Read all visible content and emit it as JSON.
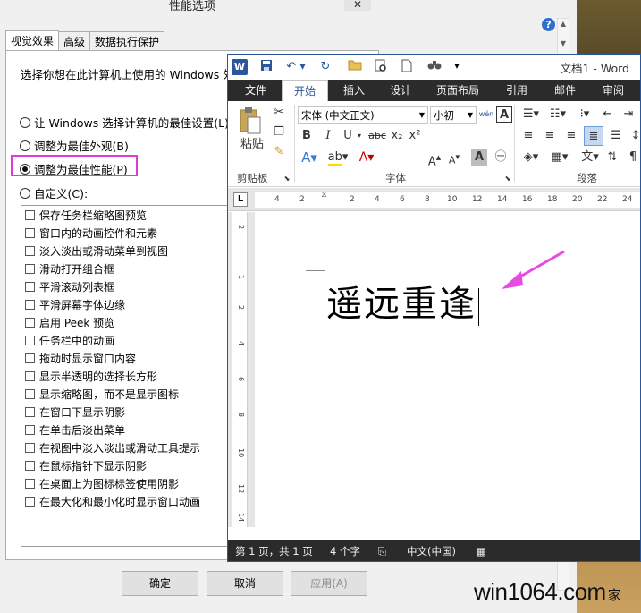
{
  "perf_dialog": {
    "title": "性能选项",
    "close": "✕",
    "tabs": [
      "视觉效果",
      "高级",
      "数据执行保护"
    ],
    "intro": "选择你想在此计算机上使用的 Windows 外",
    "radios": [
      {
        "label": "让 Windows 选择计算机的最佳设置(L)",
        "selected": false
      },
      {
        "label": "调整为最佳外观(B)",
        "selected": false
      },
      {
        "label": "调整为最佳性能(P)",
        "selected": true
      },
      {
        "label": "自定义(C):",
        "selected": false
      }
    ],
    "effects": [
      "保存任务栏缩略图预览",
      "窗口内的动画控件和元素",
      "淡入淡出或滑动菜单到视图",
      "滑动打开组合框",
      "平滑滚动列表框",
      "平滑屏幕字体边缘",
      "启用 Peek 预览",
      "任务栏中的动画",
      "拖动时显示窗口内容",
      "显示半透明的选择长方形",
      "显示缩略图，而不是显示图标",
      "在窗口下显示阴影",
      "在单击后淡出菜单",
      "在视图中淡入淡出或滑动工具提示",
      "在鼠标指针下显示阴影",
      "在桌面上为图标标签使用阴影",
      "在最大化和最小化时显示窗口动画"
    ],
    "buttons": {
      "ok": "确定",
      "cancel": "取消",
      "apply": "应用(A)"
    },
    "highlight_color": "#e03ad6"
  },
  "word": {
    "title": "文档1 - Word",
    "logo": "W",
    "tabs": [
      "文件",
      "开始",
      "插入",
      "设计",
      "页面布局",
      "引用",
      "邮件",
      "审阅"
    ],
    "active_tab": "开始",
    "clipboard": {
      "paste": "粘贴",
      "group": "剪贴板"
    },
    "font": {
      "name": "宋体 (中文正文)",
      "size": "小初",
      "group": "字体",
      "bold": "B",
      "italic": "I",
      "underline": "U",
      "strike": "abc",
      "sub": "x₂",
      "sup": "x²",
      "phonetic": "wén",
      "border_a": "A"
    },
    "paragraph": {
      "group": "段落"
    },
    "ruler_marks": [
      "4",
      "2",
      "2",
      "4",
      "6",
      "8",
      "10",
      "12",
      "14",
      "16",
      "18",
      "20",
      "22",
      "24"
    ],
    "vruler_marks": [
      "2",
      "1",
      "2",
      "4",
      "6",
      "8",
      "10",
      "12",
      "14"
    ],
    "tab_corner": "L",
    "document_text": "遥远重逢",
    "status": {
      "page": "第 1 页，共 1 页",
      "words": "4 个字",
      "language": "中文(中国)"
    },
    "accent_color": "#2b579a"
  },
  "background": {
    "help": "?"
  },
  "watermark": {
    "site": "win1064.com",
    "suffix": "家"
  },
  "annotation": {
    "arrow_color": "#e84be0"
  }
}
